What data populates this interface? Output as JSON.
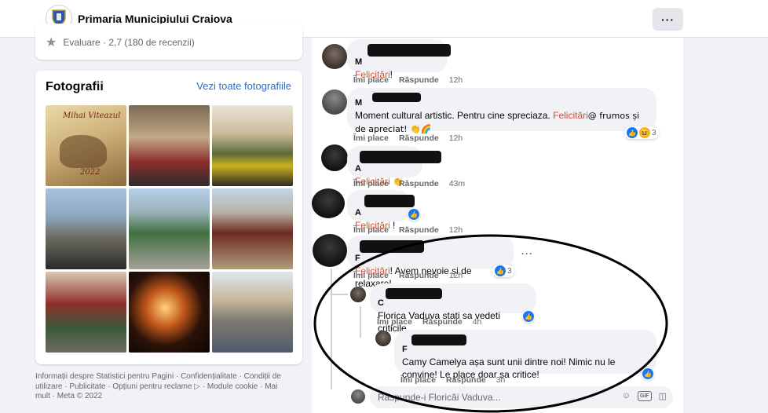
{
  "header": {
    "page_name": "Primaria Municipiului Craiova",
    "more_label": "···"
  },
  "rating": {
    "text": "Evaluare · 2,7 (180 de recenzii)"
  },
  "photos": {
    "title": "Fotografii",
    "see_all": "Vezi toate fotografiile",
    "poster_text": "Mihai Viteazul",
    "poster_year": "2022"
  },
  "footer": {
    "text": "Informații despre Statistici pentru Pagini · Confidențialitate · Condiții de utilizare · Publicitate · Opțiuni pentru reclame ▷ · Module cookie · Mai mult · Meta © 2022"
  },
  "comments": [
    {
      "author": "M",
      "felicitari": "Felicitări",
      "text": "!",
      "like": "Îmi place",
      "reply": "Răspunde",
      "time": "12h"
    },
    {
      "author": "M",
      "text_before": "Moment cultural artistic. Pentru cine spreciaza. ",
      "felicitari": "Felicitări",
      "text_after": "@ frumos și de apreciat! 👏🌈",
      "like": "Îmi place",
      "reply": "Răspunde",
      "time": "12h",
      "reactions": "3"
    },
    {
      "author": "A",
      "felicitari": "Felicitări",
      "text": " 👏",
      "like": "Îmi place",
      "reply": "Răspunde",
      "time": "43m"
    },
    {
      "author": "A",
      "felicitari": "Felicitări",
      "text": " !",
      "like": "Îmi place",
      "reply": "Răspunde",
      "time": "12h"
    },
    {
      "author": "F",
      "felicitari": "Felicitări",
      "text": "! Avem nevoie și de relaxare!",
      "like": "Îmi place",
      "reply": "Răspunde",
      "time": "12h",
      "reactions": "3"
    }
  ],
  "replies": [
    {
      "author": "C",
      "text": "Florica Vaduva stati sa vedeti criticile",
      "like": "Îmi place",
      "reply": "Răspunde",
      "time": "4h"
    },
    {
      "author": "F",
      "text": "Camy Camelya așa sunt unii dintre noi! Nimic nu le convine! Le place doar sa critice!",
      "like": "Îmi place",
      "reply": "Răspunde",
      "time": "3h"
    }
  ],
  "reply_box": {
    "placeholder": "Răspunde-i Floricăi Vaduva..."
  },
  "icons": {
    "gif": "GIF"
  },
  "colors": {
    "felicitari": "#d84a2a",
    "link": "#216fdb",
    "like": "#1877f2"
  }
}
